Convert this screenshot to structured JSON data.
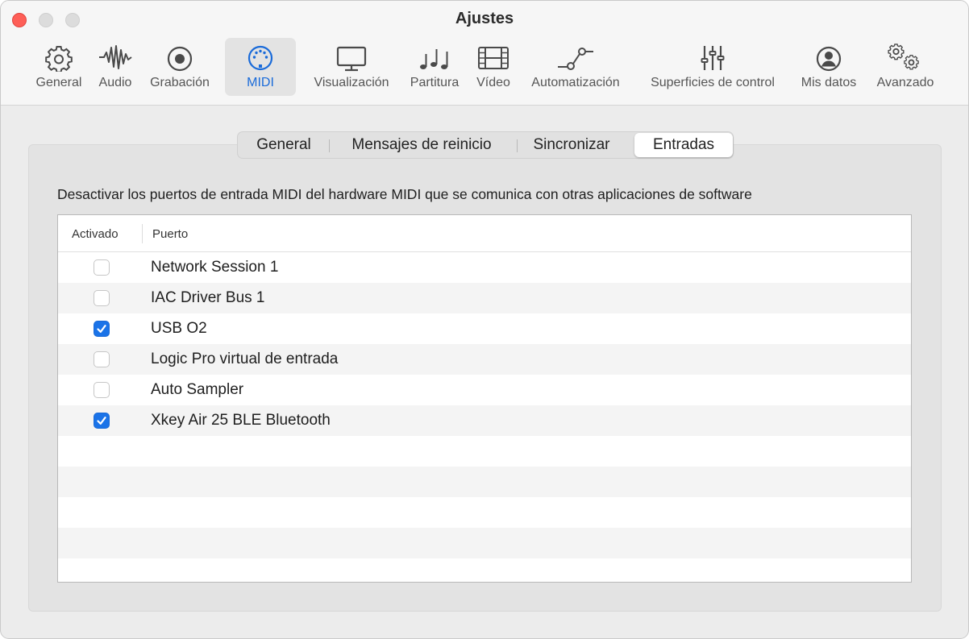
{
  "window": {
    "title": "Ajustes"
  },
  "toolbar": {
    "items": [
      {
        "label": "General",
        "icon": "gear-icon"
      },
      {
        "label": "Audio",
        "icon": "waveform-icon"
      },
      {
        "label": "Grabación",
        "icon": "record-icon"
      },
      {
        "label": "MIDI",
        "icon": "midi-connector-icon",
        "active": true
      },
      {
        "label": "Visualización",
        "icon": "display-icon"
      },
      {
        "label": "Partitura",
        "icon": "music-notes-icon"
      },
      {
        "label": "Vídeo",
        "icon": "film-icon"
      },
      {
        "label": "Automatización",
        "icon": "automation-curve-icon"
      },
      {
        "label": "Superficies de control",
        "icon": "faders-icon"
      },
      {
        "label": "Mis datos",
        "icon": "person-icon"
      },
      {
        "label": "Avanzado",
        "icon": "gears-icon"
      }
    ]
  },
  "tabs": {
    "items": [
      "General",
      "Mensajes de reinicio",
      "Sincronizar",
      "Entradas"
    ],
    "selected": "Entradas"
  },
  "description": "Desactivar los puertos de entrada MIDI del hardware MIDI que se comunica con otras aplicaciones de software",
  "table": {
    "columns": {
      "enabled": "Activado",
      "port": "Puerto"
    },
    "rows": [
      {
        "port": "Network Session 1",
        "enabled": false
      },
      {
        "port": "IAC Driver Bus 1",
        "enabled": false
      },
      {
        "port": "USB O2",
        "enabled": true
      },
      {
        "port": "Logic Pro virtual de entrada",
        "enabled": false
      },
      {
        "port": "Auto Sampler",
        "enabled": false
      },
      {
        "port": "Xkey Air 25 BLE Bluetooth",
        "enabled": true
      }
    ]
  },
  "colors": {
    "accent": "#1a73e8",
    "close": "#fe5f57"
  }
}
